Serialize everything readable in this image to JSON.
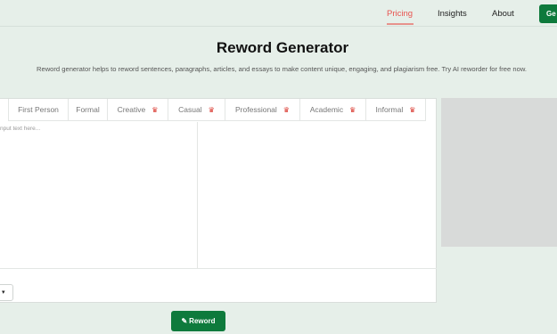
{
  "nav": {
    "links": [
      "Pricing",
      "Insights",
      "About"
    ],
    "active": "Pricing",
    "cta_label": "Ge"
  },
  "hero": {
    "title": "Reword Generator",
    "description": "Reword generator helps to reword sentences, paragraphs, articles, and essays to make content unique, engaging, and plagiarism free. Try AI reworder for free now."
  },
  "editor": {
    "tabs": [
      {
        "label": "First Person",
        "premium": false
      },
      {
        "label": "Formal",
        "premium": false
      },
      {
        "label": "Creative",
        "premium": true
      },
      {
        "label": "Casual",
        "premium": true
      },
      {
        "label": "Professional",
        "premium": true
      },
      {
        "label": "Academic",
        "premium": true
      },
      {
        "label": "Informal",
        "premium": true
      }
    ],
    "input_placeholder": "nput text here...",
    "output_value": "",
    "language_select": "▾"
  },
  "actions": {
    "reword_label": "Reword",
    "reword_icon": "pencil-icon"
  },
  "colors": {
    "background": "#e6efe9",
    "accent_green": "#0e7a3c",
    "active_link": "#e8534f",
    "premium_crown": "#d9342b"
  }
}
